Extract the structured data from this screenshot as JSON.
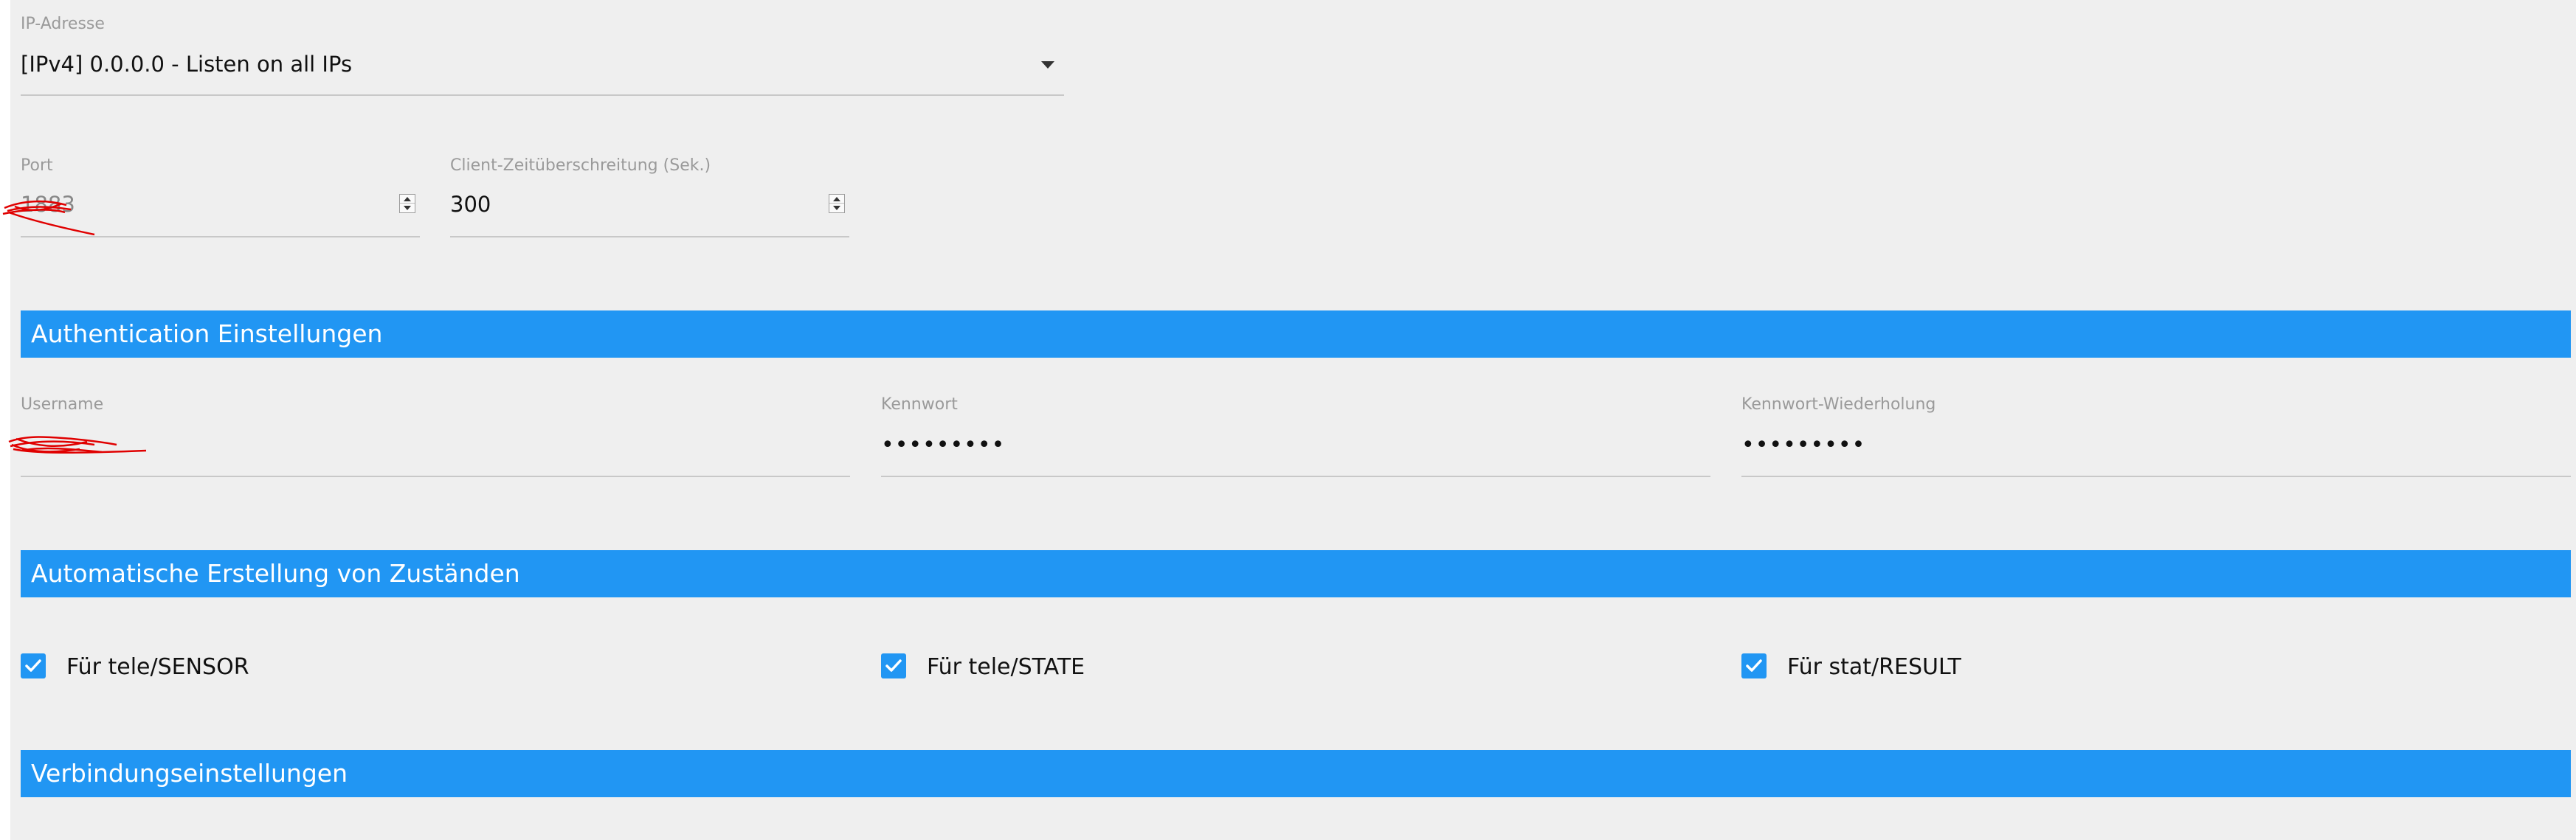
{
  "ip_address": {
    "label": "IP-Adresse",
    "value": "[IPv4] 0.0.0.0 - Listen on all IPs"
  },
  "port": {
    "label": "Port",
    "value": "1883"
  },
  "client_timeout": {
    "label": "Client-Zeitüberschreitung (Sek.)",
    "value": "300"
  },
  "auth_section": {
    "title": "Authentication Einstellungen"
  },
  "username": {
    "label": "Username",
    "value": ""
  },
  "password": {
    "label": "Kennwort",
    "value": "•••••••••"
  },
  "password_repeat": {
    "label": "Kennwort-Wiederholung",
    "value": "•••••••••"
  },
  "auto_states_section": {
    "title": "Automatische Erstellung von Zuständen"
  },
  "checkboxes": {
    "tele_sensor": {
      "label": "Für tele/SENSOR",
      "checked": true
    },
    "tele_state": {
      "label": "Für tele/STATE",
      "checked": true
    },
    "stat_result": {
      "label": "Für stat/RESULT",
      "checked": true
    }
  },
  "connection_section": {
    "title": "Verbindungseinstellungen"
  },
  "colors": {
    "accent": "#2196f3",
    "background": "#efefef",
    "redaction": "#e00000"
  },
  "icons": {
    "dropdown": "caret-down-icon",
    "spinner": "spinner-arrows-icon",
    "checkbox": "check-icon"
  }
}
